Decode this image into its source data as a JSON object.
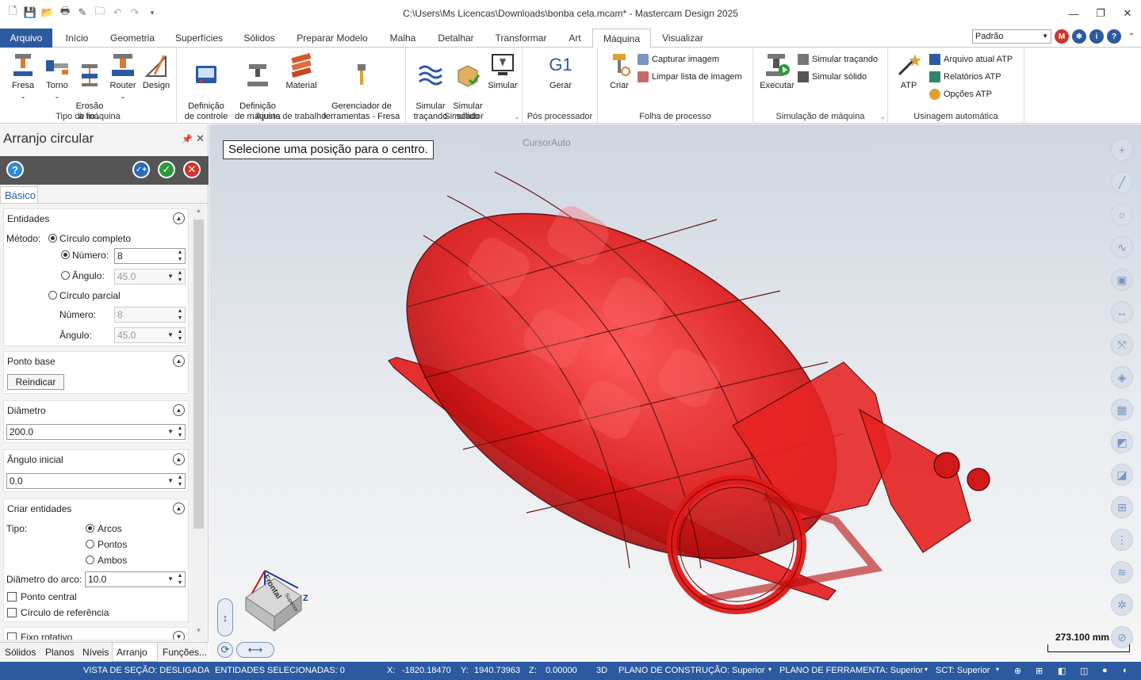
{
  "window": {
    "title": "C:\\Users\\Ms Licencas\\Downloads\\bonba cela.mcam* - Mastercam Design 2025"
  },
  "tabs": [
    "Arquivo",
    "Início",
    "Geometria",
    "Superfícies",
    "Sólidos",
    "Preparar Modelo",
    "Malha",
    "Detalhar",
    "Transformar",
    "Art",
    "Máquina",
    "Visualizar"
  ],
  "active_tab": "Máquina",
  "profile": "Padrão",
  "ribbon": {
    "tipo_maquina": {
      "label": "Tipo de máquina",
      "buttons": [
        "Fresa",
        "Torno",
        "Erosão\nà fio",
        "Router",
        "Design"
      ]
    },
    "ajuste": {
      "label": "Ajuste de trabalho",
      "buttons": [
        "Definição\nde controle",
        "Definição\nde máquina",
        "Material",
        "Gerenciador de\nferramentas - Fresa"
      ]
    },
    "simulador": {
      "label": "Simulador",
      "buttons": [
        "Simular\ntraçando",
        "Simular\nsólido",
        "Simular"
      ]
    },
    "pos": {
      "label": "Pós processador",
      "button": "Gerar",
      "icon_text": "G1"
    },
    "folha": {
      "label": "Folha de processo",
      "button": "Criar",
      "small": [
        "Capturar imagem",
        "Limpar lista de imagem"
      ]
    },
    "simulacao": {
      "label": "Simulação de máquina",
      "button": "Executar",
      "small": [
        "Simular traçando",
        "Simular sólido"
      ]
    },
    "usinagem": {
      "label": "Usinagem automática",
      "button": "ATP",
      "small": [
        "Arquivo atual ATP",
        "Relatórios ATP",
        "Opções ATP"
      ]
    }
  },
  "panel": {
    "title": "Arranjo circular",
    "tab": "Básico",
    "entidades": {
      "title": "Entidades",
      "metodo_label": "Método:",
      "circulo_completo": "Círculo completo",
      "numero_label": "Número:",
      "numero_value": "8",
      "angulo_label": "Ângulo:",
      "angulo_value": "45.0",
      "circulo_parcial": "Círculo parcial",
      "numero2_label": "Número:",
      "numero2_value": "8",
      "angulo2_label": "Ângulo:",
      "angulo2_value": "45.0"
    },
    "ponto_base": {
      "title": "Ponto base",
      "button": "Reindicar"
    },
    "diametro": {
      "title": "Diâmetro",
      "value": "200.0"
    },
    "angulo_inicial": {
      "title": "Ângulo inicial",
      "value": "0.0"
    },
    "criar": {
      "title": "Criar entidades",
      "tipo_label": "Tipo:",
      "options": [
        "Arcos",
        "Pontos",
        "Ambos"
      ],
      "diametro_arco_label": "Diâmetro do arco:",
      "diametro_arco_value": "10.0",
      "ponto_central": "Ponto central",
      "circulo_referencia": "Círculo de referência"
    },
    "fixo": "Fixo rotativo",
    "bottom_tabs": [
      "Sólidos",
      "Planos",
      "Níveis",
      "Arranjo ...",
      "Funções..."
    ]
  },
  "viewport": {
    "prompt": "Selecione uma posição para o centro.",
    "cursor_mode": "CursorAuto",
    "scale": "273.100 mm",
    "view_cube": {
      "front": "Frontal",
      "top": "Superior"
    }
  },
  "status": {
    "vista": "VISTA DE SEÇÃO: DESLIGADA",
    "entidades": "ENTIDADES SELECIONADAS: 0",
    "x_label": "X:",
    "x": "-1820.18470",
    "y_label": "Y:",
    "y": "1940.73963",
    "z_label": "Z:",
    "z": "0.00000",
    "mode": "3D",
    "plano_construcao": "PLANO DE CONSTRUÇÃO: Superior",
    "plano_ferramenta": "PLANO DE FERRAMENTA: Superior",
    "sct": "SCT: Superior"
  },
  "colors": {
    "accent": "#2c5aa0",
    "model": "#e01818"
  }
}
